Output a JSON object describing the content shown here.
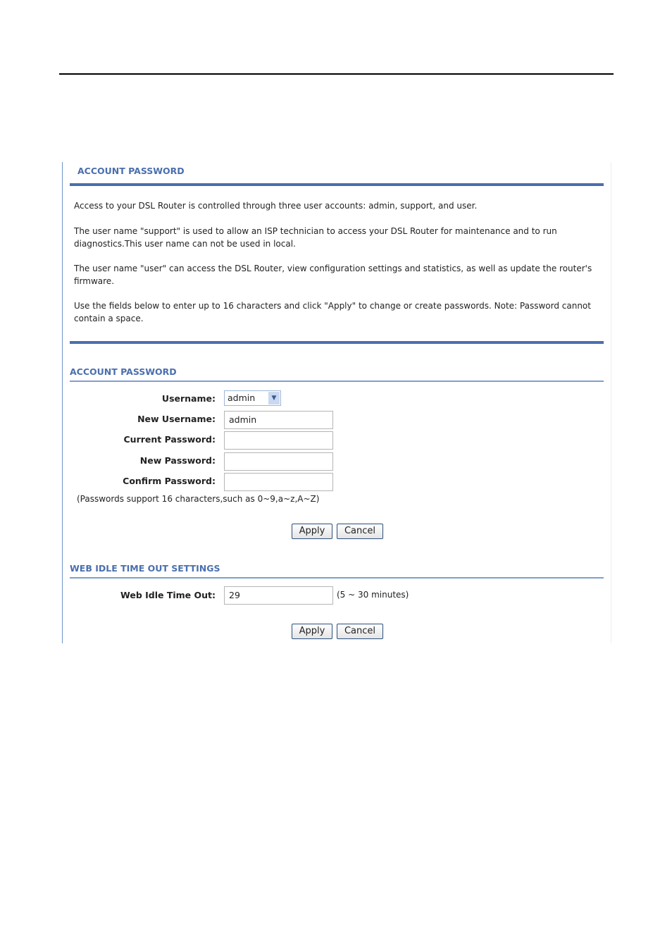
{
  "section1": {
    "title": "ACCOUNT PASSWORD",
    "paragraphs": [
      "Access to your DSL Router is controlled through three user accounts: admin, support, and user.",
      "The user name \"support\" is used to allow an ISP technician to access your DSL Router for maintenance and to run diagnostics.This user name can not be used in local.",
      "The user name \"user\" can access the DSL Router, view configuration settings and statistics, as well as update the router's firmware.",
      "Use the fields below to enter up to 16 characters and click \"Apply\" to change or create passwords. Note: Password cannot contain a space."
    ]
  },
  "section2": {
    "title": "ACCOUNT PASSWORD",
    "username_label": "Username:",
    "username_value": "admin",
    "new_username_label": "New Username:",
    "new_username_value": "admin",
    "current_password_label": "Current Password:",
    "new_password_label": "New Password:",
    "confirm_password_label": "Confirm Password:",
    "hint": "(Passwords support 16 characters,such as 0~9,a~z,A~Z)",
    "apply": "Apply",
    "cancel": "Cancel"
  },
  "section3": {
    "title": "WEB IDLE TIME OUT SETTINGS",
    "label": "Web Idle Time Out:",
    "value": "29",
    "range": "(5 ~ 30 minutes)",
    "apply": "Apply",
    "cancel": "Cancel"
  }
}
